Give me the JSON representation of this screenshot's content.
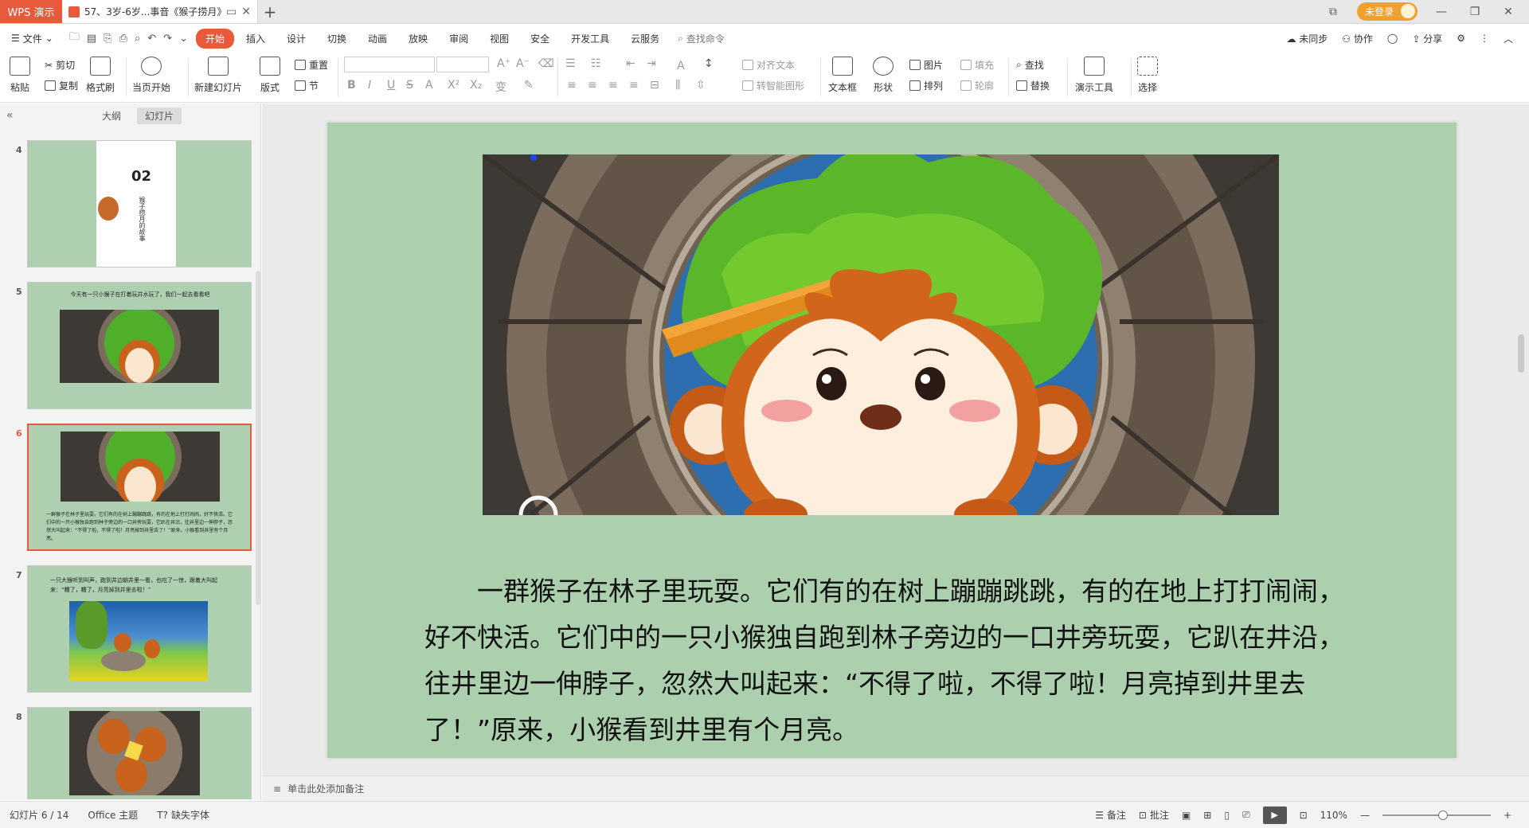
{
  "titlebar": {
    "app_tab": "WPS 演示",
    "doc_title": "57、3岁-6岁...事音《猴子捞月》",
    "login_label": "未登录"
  },
  "menu": {
    "file_label": "文件",
    "tabs": [
      "开始",
      "插入",
      "设计",
      "切换",
      "动画",
      "放映",
      "审阅",
      "视图",
      "安全",
      "开发工具",
      "云服务"
    ],
    "active_tab": "开始",
    "search_label": "查找命令",
    "right_items": [
      "未同步",
      "协作",
      "分享"
    ]
  },
  "ribbon": {
    "paste": "粘贴",
    "cut": "剪切",
    "copy": "复制",
    "format_painter": "格式刷",
    "from_current": "当页开始",
    "new_slide": "新建幻灯片",
    "layout": "版式",
    "reset": "重置",
    "section": "节",
    "align_text": "对齐文本",
    "smart_graphic": "转智能图形",
    "textbox": "文本框",
    "shape": "形状",
    "picture": "图片",
    "arrange": "排列",
    "fill": "填充",
    "outline": "轮廓",
    "find": "查找",
    "replace": "替换",
    "present_tools": "演示工具",
    "select": "选择"
  },
  "panel": {
    "tab_outline": "大纲",
    "tab_slides": "幻灯片",
    "thumbnails": [
      {
        "num": "4",
        "heading": "02",
        "caption": "猴子捞月的故事"
      },
      {
        "num": "5",
        "caption": "今天有一只小猴子在打着玩井水玩了，我们一起去看看吧"
      },
      {
        "num": "6",
        "caption": "一群猴子在林子里玩耍。它们有的在树上蹦蹦跳跳，有的在地上打打闹闹，好不快活。它们中的一只小猴独自跑到林子旁边的一口井旁玩耍，它趴在井沿，往井里边一伸脖子，忽然大叫起来：“不得了啦，不得了啦！月亮掉到井里去了！”原来，小猴看到井里有个月亮。"
      },
      {
        "num": "7",
        "caption": "一只大猴听到叫声，跑到井边朝井里一看，也吃了一惊，跟着大叫起来：“糟了，糟了，月亮掉到井里去啦！”"
      },
      {
        "num": "8",
        "caption": ""
      }
    ]
  },
  "slide": {
    "text": "一群猴子在林子里玩耍。它们有的在树上蹦蹦跳跳，有的在地上打打闹闹，好不快活。它们中的一只小猴独自跑到林子旁边的一口井旁玩耍，它趴在井沿，往井里边一伸脖子，忽然大叫起来：“不得了啦，不得了啦！月亮掉到井里去了！”原来，小猴看到井里有个月亮。"
  },
  "notes": {
    "placeholder": "单击此处添加备注"
  },
  "status": {
    "slide_counter": "幻灯片 6 / 14",
    "theme": "Office 主题",
    "missing_font": "缺失字体",
    "notes_btn": "备注",
    "comments_btn": "批注",
    "zoom": "110%"
  },
  "colors": {
    "accent": "#e85a3c",
    "slide_bg": "#acd0ae"
  }
}
